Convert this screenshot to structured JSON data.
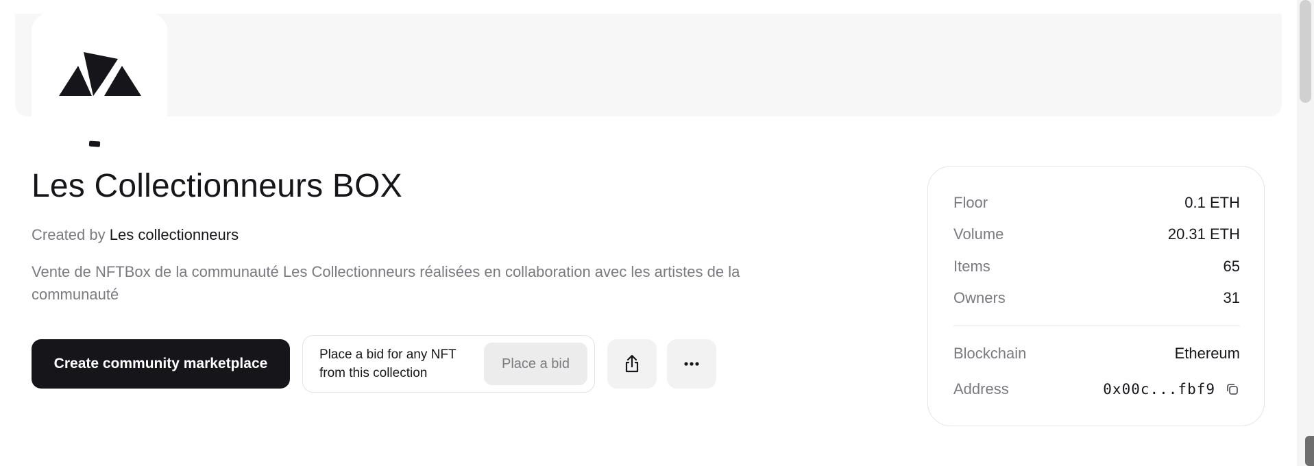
{
  "collection": {
    "title": "Les Collectionneurs BOX",
    "created_by_prefix": "Created by",
    "creator": "Les collectionneurs",
    "description": "Vente de NFTBox de la communauté Les Collectionneurs réalisées en collaboration avec les artistes de la communauté"
  },
  "actions": {
    "create_marketplace_label": "Create community marketplace",
    "bid_prompt": "Place a bid for any NFT from this collection",
    "place_bid_label": "Place a bid",
    "share_icon": "share-icon",
    "more_icon": "more-icon"
  },
  "stats": {
    "floor_label": "Floor",
    "floor_value": "0.1 ETH",
    "volume_label": "Volume",
    "volume_value": "20.31 ETH",
    "items_label": "Items",
    "items_value": "65",
    "owners_label": "Owners",
    "owners_value": "31",
    "blockchain_label": "Blockchain",
    "blockchain_value": "Ethereum",
    "address_label": "Address",
    "address_value": "0x00c...fbf9"
  },
  "colors": {
    "primary": "#16161a",
    "muted_text": "#7a7a80",
    "banner": "#f7f7f7"
  }
}
